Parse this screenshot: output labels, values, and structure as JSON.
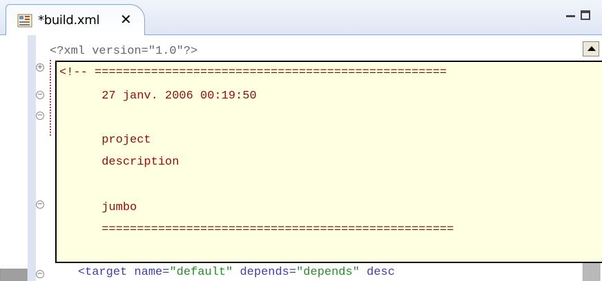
{
  "tab": {
    "title": "*build.xml",
    "close_label": "✕",
    "icon": "ant-build-file-icon"
  },
  "window_controls": {
    "minimize_icon": "minimize-icon",
    "maximize_icon": "maximize-icon"
  },
  "editor": {
    "first_line": "<?xml version=\"1.0\"?>",
    "last_line": {
      "indent": "    ",
      "tag_open": "<target name=",
      "name_value": "\"default\"",
      "depends_attr": " depends=",
      "depends_value": "\"depends\"",
      "trailing": " desc"
    }
  },
  "popup": {
    "lines": [
      "<!-- ==================================================",
      "      27 janv. 2006 00:19:50",
      "",
      "      project",
      "      description",
      "",
      "      jumbo",
      "      =================================================="
    ]
  },
  "colors": {
    "popup_background": "#ffffe1",
    "comment_text": "#8b1010",
    "string_value": "#2a8a2a",
    "tag_text": "#3f3f9f"
  }
}
